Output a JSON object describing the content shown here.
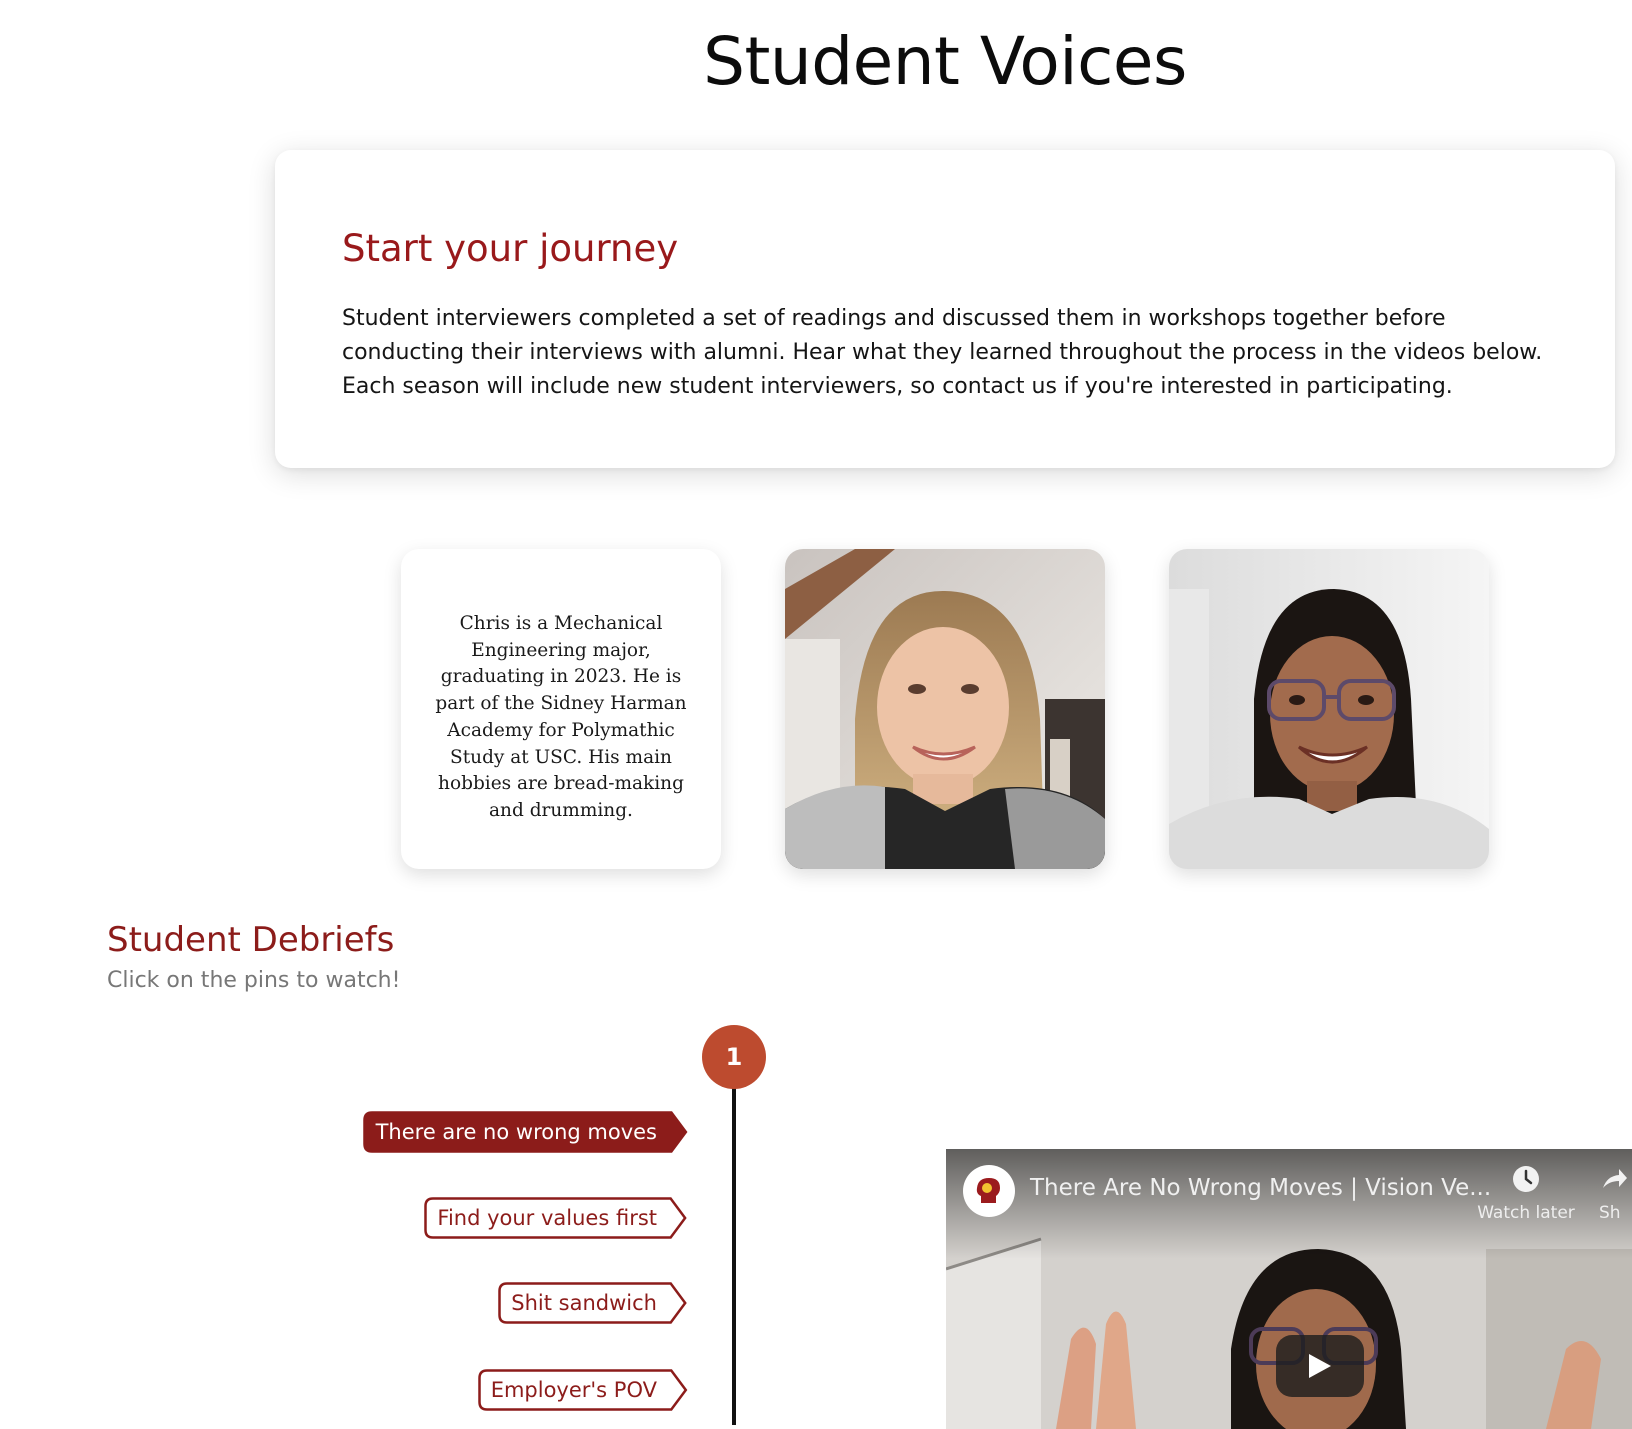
{
  "page": {
    "title": "Student Voices"
  },
  "intro": {
    "heading": "Start your journey",
    "body": "Student interviewers completed a set of readings and discussed them in workshops together before conducting their interviews with alumni. Hear what they learned throughout the process in the videos below. Each season will include new student interviewers, so contact us if you're interested in participating."
  },
  "profiles": [
    {
      "type": "text",
      "text": "Chris is a Mechanical Engineering major, graduating in 2023. He is part of the Sidney Harman Academy for Polymathic Study at USC. His main hobbies are bread-making and drumming."
    },
    {
      "type": "photo"
    },
    {
      "type": "photo"
    }
  ],
  "debriefs": {
    "title": "Student Debriefs",
    "subtitle": "Click on the pins to watch!",
    "pin_number": "1",
    "tags": [
      {
        "label": "There are no wrong moves",
        "active": true
      },
      {
        "label": "Find your values first",
        "active": false
      },
      {
        "label": "Shit sandwich",
        "active": false
      },
      {
        "label": "Employer's POV",
        "active": false
      }
    ]
  },
  "video": {
    "title": "There Are No Wrong Moves | Vision Ve...",
    "watch_later_label": "Watch later",
    "share_label": "Sh"
  },
  "colors": {
    "brand_red": "#8c1c1a",
    "pin_orange": "#bd4b2f"
  },
  "icons": {
    "watch_later": "clock-icon",
    "share": "share-arrow-icon",
    "play": "play-icon",
    "channel": "channel-head-logo"
  }
}
